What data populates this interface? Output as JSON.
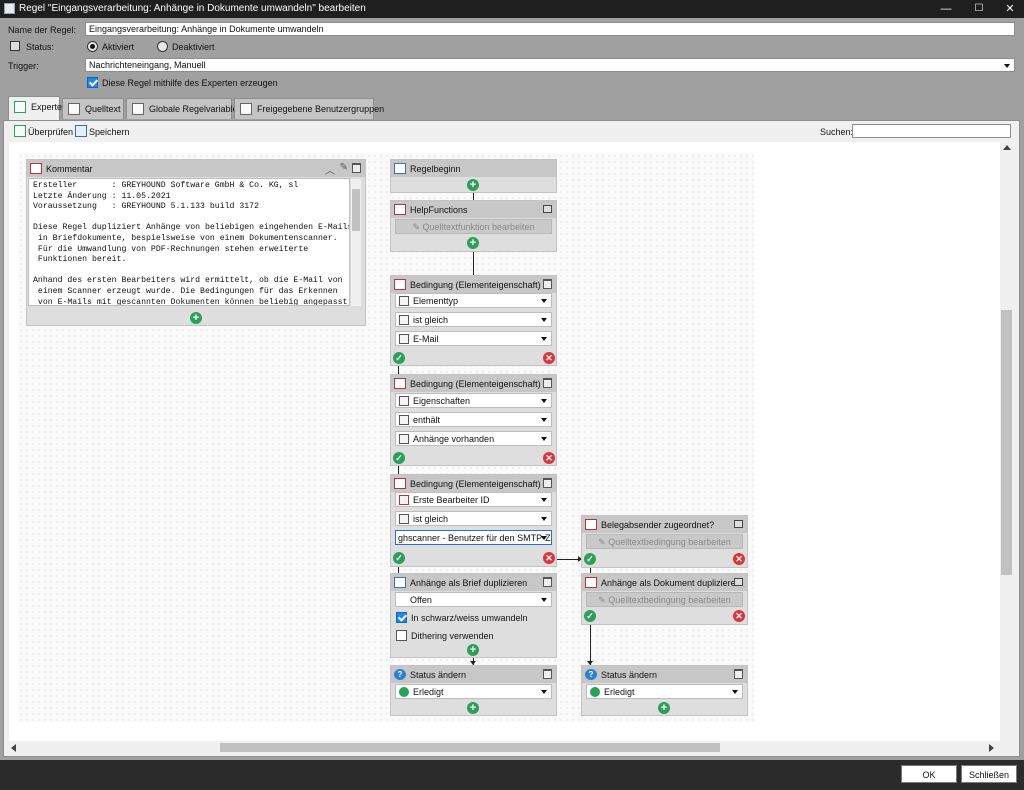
{
  "window": {
    "title": "Regel \"Eingangsverarbeitung: Anhänge in Dokumente umwandeln\" bearbeiten",
    "minimize": "—",
    "maximize": "☐",
    "close": "✕"
  },
  "form": {
    "name_label": "Name der Regel:",
    "name_value": "Eingangsverarbeitung: Anhänge in Dokumente umwandeln",
    "status_label": "Status:",
    "status_active": "Aktiviert",
    "status_inactive": "Deaktiviert",
    "trigger_label": "Trigger:",
    "trigger_value": "Nachrichteneingang, Manuell",
    "expert_checkbox": "Diese Regel mithilfe des Experten erzeugen"
  },
  "tabs": [
    {
      "label": "Experte"
    },
    {
      "label": "Quelltext"
    },
    {
      "label": "Globale Regelvariablen"
    },
    {
      "label": "Freigegebene Benutzergruppen"
    }
  ],
  "toolbar": {
    "check": "Überprüfen",
    "save": "Speichern",
    "search_label": "Suchen:",
    "search_value": ""
  },
  "comment": {
    "title": "Kommentar",
    "text": "Ersteller       : GREYHOUND Software GmbH & Co. KG, sl\nLetzte Änderung : 11.05.2021\nVoraussetzung   : GREYHOUND 5.1.133 build 3172\n\nDiese Regel dupliziert Anhänge von beliebigen eingehenden E-Mails\n in Briefdokumente, bespielsweise von einem Dokumentenscanner.\n Für die Umwandlung von PDF-Rechnungen stehen erweiterte\n Funktionen bereit.\n\nAnhand des ersten Bearbeiters wird ermittelt, ob die E-Mail von\n einem Scanner erzeugt wurde. Die Bedingungen für das Erkennen\n von E-Mails mit gescannten Dokumenten können beliebig angepasst"
  },
  "nodes": {
    "start": {
      "title": "Regelbeginn"
    },
    "help": {
      "title": "HelpFunctions",
      "button": "Quelltextfunktion bearbeiten"
    },
    "cond1": {
      "title": "Bedingung (Elementeigenschaft)",
      "f1": "Elementtyp",
      "f2": "ist gleich",
      "f3": "E-Mail"
    },
    "cond2": {
      "title": "Bedingung (Elementeigenschaft)",
      "f1": "Eigenschaften",
      "f2": "enthält",
      "f3": "Anhänge vorhanden"
    },
    "cond3": {
      "title": "Bedingung (Elementeigenschaft)",
      "f1": "Erste Bearbeiter ID",
      "f2": "ist gleich",
      "f3": "ghscanner - Benutzer für den SMTP-Zug"
    },
    "sender": {
      "title": "Belegabsender zugeordnet?",
      "button": "Quelltextbedingung bearbeiten"
    },
    "dup_doc": {
      "title": "Anhänge als Dokument duplizieren",
      "button": "Quelltextbedingung bearbeiten"
    },
    "dup_letter": {
      "title": "Anhänge als Brief duplizieren",
      "f1": "Offen",
      "c1": "In schwarz/weiss umwandeln",
      "c2": "Dithering verwenden"
    },
    "status_left": {
      "title": "Status ändern",
      "f1": "Erledigt"
    },
    "status_right": {
      "title": "Status ändern",
      "f1": "Erledigt"
    }
  },
  "footer": {
    "ok": "OK",
    "close": "Schließen"
  },
  "colors": {
    "accent": "#1e88e5",
    "ok_green": "#2e9e5b",
    "fail_red": "#d9363e"
  }
}
